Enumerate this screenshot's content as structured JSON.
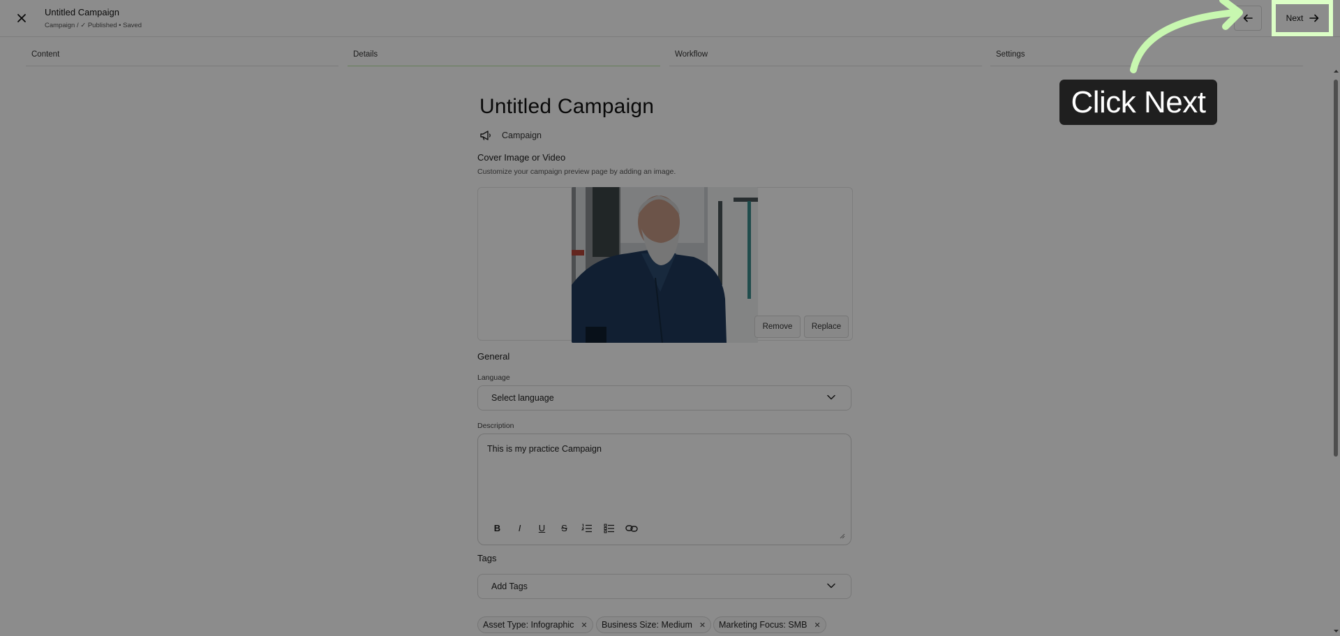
{
  "header": {
    "title": "Untitled Campaign",
    "subtitle": "Campaign / ✓ Published • Saved",
    "next_label": "Next"
  },
  "tabs": [
    {
      "label": "Content"
    },
    {
      "label": "Details"
    },
    {
      "label": "Workflow"
    },
    {
      "label": "Settings"
    }
  ],
  "form": {
    "title": "Untitled Campaign",
    "type_label": "Campaign",
    "cover": {
      "label": "Cover Image or Video",
      "helper": "Customize your campaign preview page by adding an image.",
      "remove_label": "Remove",
      "replace_label": "Replace"
    },
    "general": {
      "label": "General",
      "language_label": "Language",
      "language_value": "Select language",
      "description_label": "Description",
      "description_value": "This is my practice Campaign"
    },
    "tags": {
      "label": "Tags",
      "placeholder": "Add Tags",
      "chips": [
        {
          "label": "Asset Type: Infographic"
        },
        {
          "label": "Business Size: Medium"
        },
        {
          "label": "Marketing Focus: SMB"
        }
      ]
    }
  },
  "annotation": {
    "text": "Click Next"
  },
  "colors": {
    "highlight": "#dcffc6",
    "callout_bg": "#1f1f1f"
  }
}
